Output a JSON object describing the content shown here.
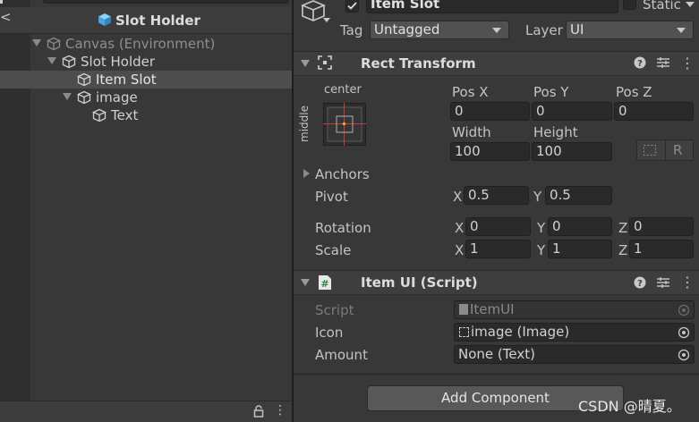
{
  "hierarchy": {
    "title": "Slot Holder",
    "back_glyph": "<",
    "items": [
      {
        "label": "Canvas (Environment)",
        "depth": 0,
        "expanded": true,
        "selected": false,
        "dimmed": true,
        "icon": "gameobject-icon"
      },
      {
        "label": "Slot Holder",
        "depth": 1,
        "expanded": true,
        "selected": false,
        "dimmed": false,
        "icon": "gameobject-icon"
      },
      {
        "label": "Item Slot",
        "depth": 2,
        "expanded": false,
        "selected": true,
        "dimmed": false,
        "icon": "gameobject-icon"
      },
      {
        "label": "image",
        "depth": 2,
        "expanded": true,
        "selected": false,
        "dimmed": false,
        "icon": "gameobject-icon"
      },
      {
        "label": "Text",
        "depth": 3,
        "expanded": false,
        "selected": false,
        "dimmed": false,
        "icon": "gameobject-icon"
      }
    ],
    "footer_more": "⋮"
  },
  "inspector": {
    "object_name": "Item Slot",
    "active": true,
    "static_label": "Static",
    "tag_label": "Tag",
    "tag_value": "Untagged",
    "layer_label": "Layer",
    "layer_value": "UI",
    "rect_transform": {
      "title": "Rect Transform",
      "anchor_h": "center",
      "anchor_v": "middle",
      "pos_x_label": "Pos X",
      "pos_x": "0",
      "pos_y_label": "Pos Y",
      "pos_y": "0",
      "pos_z_label": "Pos Z",
      "pos_z": "0",
      "width_label": "Width",
      "width": "100",
      "height_label": "Height",
      "height": "100",
      "r_button": "R",
      "anchors_label": "Anchors",
      "pivot_label": "Pivot",
      "pivot_x": "0.5",
      "pivot_y": "0.5",
      "rotation_label": "Rotation",
      "rot_x": "0",
      "rot_y": "0",
      "rot_z": "0",
      "scale_label": "Scale",
      "scale_x": "1",
      "scale_y": "1",
      "scale_z": "1",
      "axis_x": "X",
      "axis_y": "Y",
      "axis_z": "Z"
    },
    "item_ui": {
      "title": "Item UI (Script)",
      "script_label": "Script",
      "script_value": "ItemUI",
      "icon_label": "Icon",
      "icon_value": "image (Image)",
      "amount_label": "Amount",
      "amount_value": "None (Text)"
    },
    "add_component": "Add Component",
    "header_more": "⋮"
  },
  "watermark": "CSDN @晴夏。",
  "colors": {
    "panel_bg": "#383838",
    "field_bg": "#2a2a2a",
    "selected_row": "#4d4d4d",
    "anchor_red": "#c83c3c",
    "cube_blue": "#5fb6ea"
  }
}
